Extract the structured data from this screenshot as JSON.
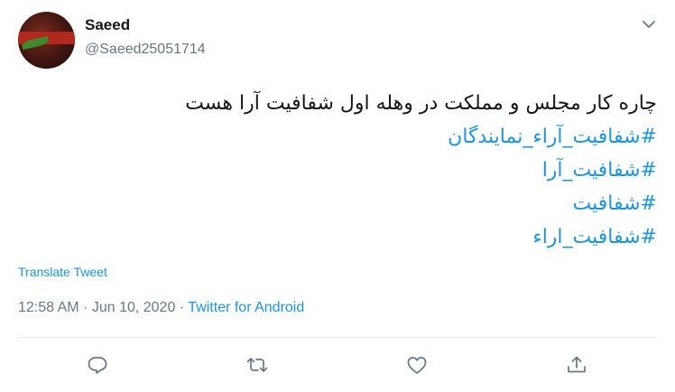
{
  "user": {
    "name": "Saeed",
    "handle": "@Saeed25051714"
  },
  "tweet": {
    "text": "چاره کار مجلس و مملکت در وهله اول شفافیت آرا هست",
    "hashtags": [
      "#شفافیت_آراء_نمایندگان",
      "#شفافیت_آرا",
      "#شفافیت",
      "#شفافیت_اراء"
    ]
  },
  "translate_label": "Translate Tweet",
  "meta": {
    "time": "12:58 AM",
    "separator1": " · ",
    "date": "Jun 10, 2020",
    "separator2": " · ",
    "source": "Twitter for Android"
  },
  "actions": [
    {
      "icon": "reply-icon"
    },
    {
      "icon": "retweet-icon"
    },
    {
      "icon": "like-icon"
    },
    {
      "icon": "share-icon"
    }
  ],
  "colors": {
    "link": "#1b95e0",
    "secondary": "#657786",
    "text": "#14171a"
  }
}
